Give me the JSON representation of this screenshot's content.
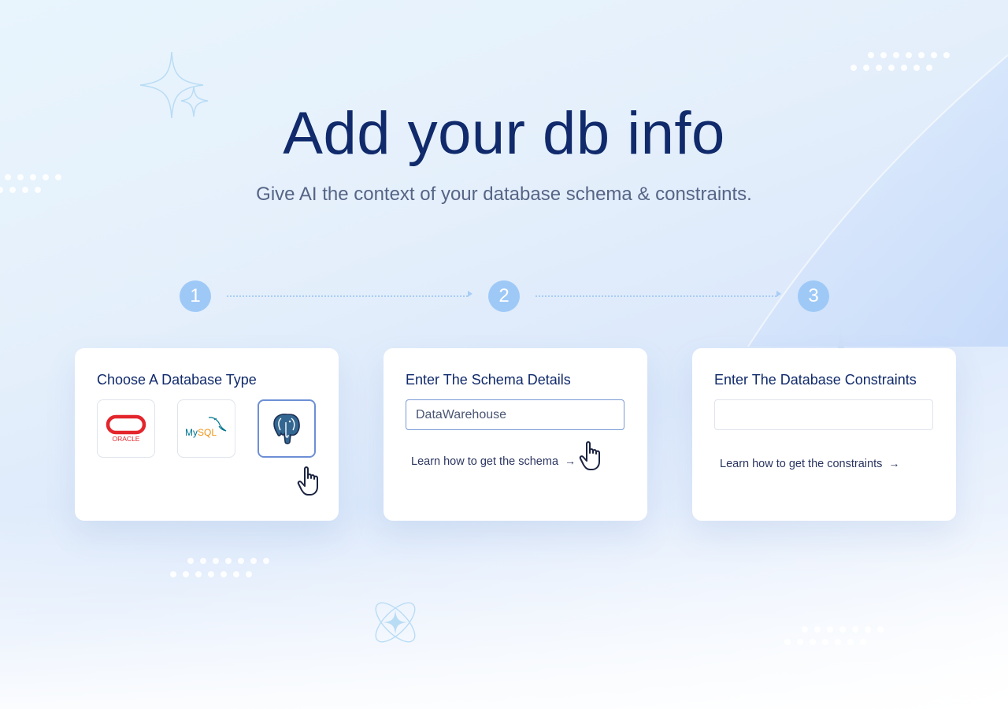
{
  "hero": {
    "title": "Add your db info",
    "subtitle": "Give AI the context of your database schema & constraints."
  },
  "steps": [
    {
      "number": "1"
    },
    {
      "number": "2"
    },
    {
      "number": "3"
    }
  ],
  "cards": {
    "database_type": {
      "title": "Choose A Database Type",
      "options": [
        {
          "label": "ORACLE",
          "icon": "oracle-logo",
          "selected": false
        },
        {
          "label": "MySQL",
          "icon": "mysql-logo",
          "selected": false
        },
        {
          "label": "PostgreSQL",
          "icon": "postgresql-logo",
          "selected": true
        }
      ]
    },
    "schema": {
      "title": "Enter The Schema Details",
      "input_value": "DataWarehouse",
      "link_label": "Learn how to get the schema",
      "link_arrow": "→"
    },
    "constraints": {
      "title": "Enter The Database Constraints",
      "input_value": "",
      "link_label": "Learn how to get the constraints",
      "link_arrow": "→"
    }
  },
  "colors": {
    "title": "#102a6b",
    "subtitle": "#566486",
    "step_badge": "#9ec9f7",
    "oracle_red": "#e3262c",
    "mysql_blue": "#00758f",
    "mysql_orange": "#f29111",
    "postgres_blue": "#336791"
  }
}
